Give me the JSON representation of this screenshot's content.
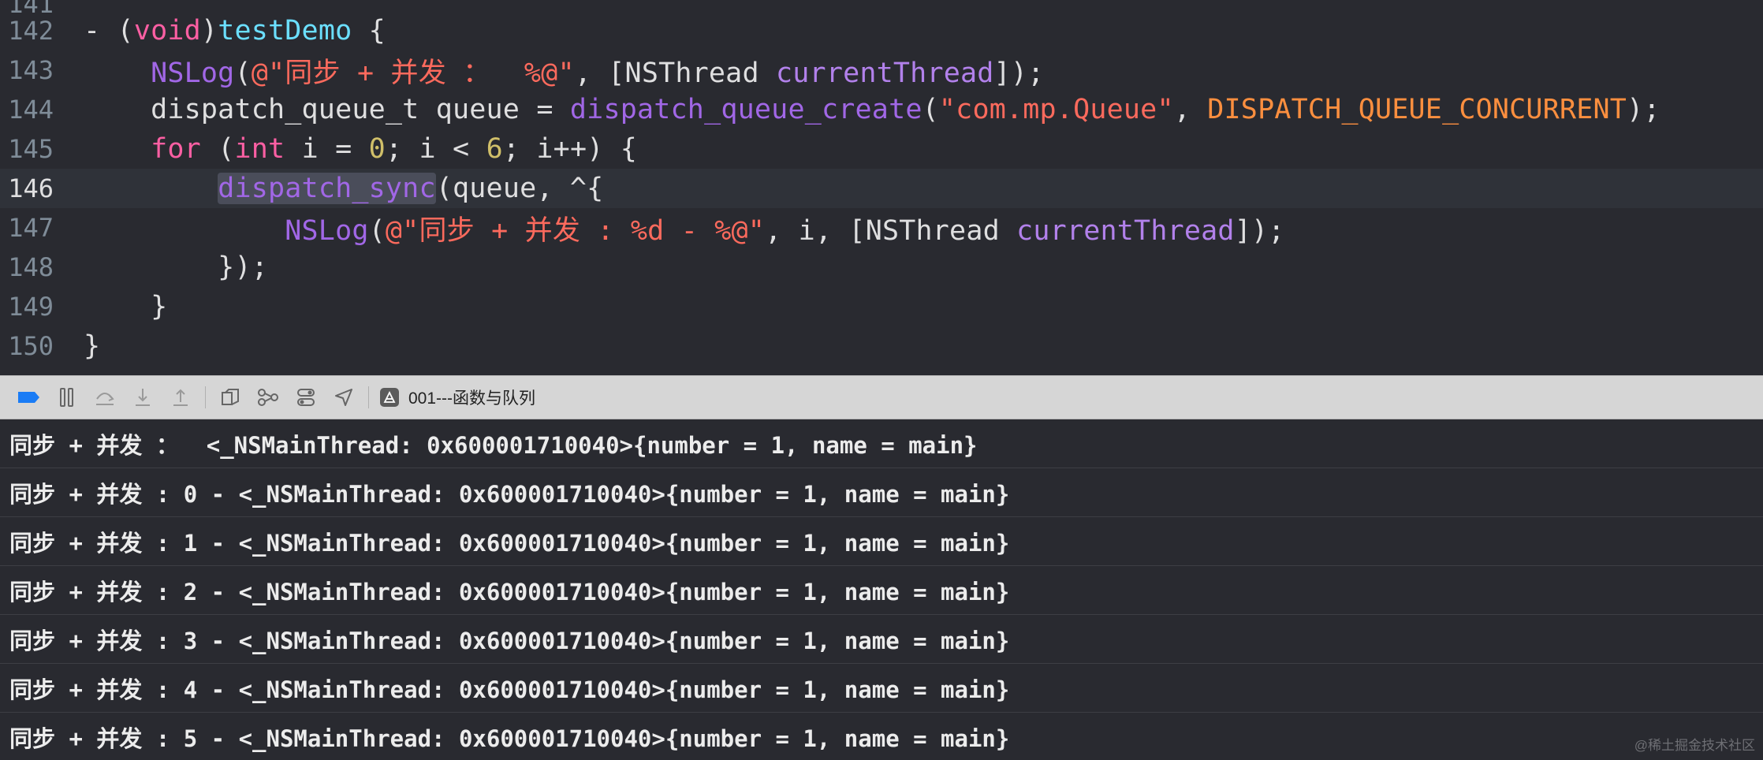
{
  "editor": {
    "lines": [
      {
        "num": "142",
        "tokens": [
          {
            "t": "- (",
            "c": ""
          },
          {
            "t": "void",
            "c": "t-kw"
          },
          {
            "t": ")",
            "c": ""
          },
          {
            "t": "testDemo",
            "c": "t-def"
          },
          {
            "t": " {",
            "c": ""
          }
        ]
      },
      {
        "num": "143",
        "tokens": [
          {
            "t": "    ",
            "c": ""
          },
          {
            "t": "NSLog",
            "c": "t-fn"
          },
          {
            "t": "(",
            "c": ""
          },
          {
            "t": "@\"同步 + 并发 ：  %@\"",
            "c": "t-str"
          },
          {
            "t": ", [NSThread ",
            "c": ""
          },
          {
            "t": "currentThread",
            "c": "t-fn2"
          },
          {
            "t": "]);",
            "c": ""
          }
        ]
      },
      {
        "num": "144",
        "tokens": [
          {
            "t": "    ",
            "c": ""
          },
          {
            "t": "dispatch_queue_t",
            "c": ""
          },
          {
            "t": " queue = ",
            "c": ""
          },
          {
            "t": "dispatch_queue_create",
            "c": "t-fn"
          },
          {
            "t": "(",
            "c": ""
          },
          {
            "t": "\"com.mp.Queue\"",
            "c": "t-str"
          },
          {
            "t": ", ",
            "c": ""
          },
          {
            "t": "DISPATCH_QUEUE_CONCURRENT",
            "c": "t-macro"
          },
          {
            "t": ");",
            "c": ""
          }
        ]
      },
      {
        "num": "145",
        "tokens": [
          {
            "t": "    ",
            "c": ""
          },
          {
            "t": "for",
            "c": "t-kw"
          },
          {
            "t": " (",
            "c": ""
          },
          {
            "t": "int",
            "c": "t-kw"
          },
          {
            "t": " i = ",
            "c": ""
          },
          {
            "t": "0",
            "c": "t-num"
          },
          {
            "t": "; i < ",
            "c": ""
          },
          {
            "t": "6",
            "c": "t-num"
          },
          {
            "t": "; i++) {",
            "c": ""
          }
        ]
      },
      {
        "num": "146",
        "current": true,
        "tokens": [
          {
            "t": "        ",
            "c": ""
          },
          {
            "t": "dispatch_sync",
            "c": "t-fn hl"
          },
          {
            "t": "(queue, ^{",
            "c": ""
          }
        ]
      },
      {
        "num": "147",
        "tokens": [
          {
            "t": "            ",
            "c": ""
          },
          {
            "t": "NSLog",
            "c": "t-fn"
          },
          {
            "t": "(",
            "c": ""
          },
          {
            "t": "@\"同步 + 并发 : %d - %@\"",
            "c": "t-str"
          },
          {
            "t": ", i, [NSThread ",
            "c": ""
          },
          {
            "t": "currentThread",
            "c": "t-fn2"
          },
          {
            "t": "]);",
            "c": ""
          }
        ]
      },
      {
        "num": "148",
        "tokens": [
          {
            "t": "        });",
            "c": ""
          }
        ]
      },
      {
        "num": "149",
        "tokens": [
          {
            "t": "    }",
            "c": ""
          }
        ]
      },
      {
        "num": "150",
        "tokens": [
          {
            "t": "}",
            "c": ""
          }
        ]
      }
    ]
  },
  "toolbar": {
    "buttons": [
      {
        "name": "breakpoints-toggle-icon",
        "interactable": true
      },
      {
        "name": "pause-icon",
        "interactable": true
      },
      {
        "name": "step-over-icon",
        "interactable": true
      },
      {
        "name": "step-into-icon",
        "interactable": true
      },
      {
        "name": "step-out-icon",
        "interactable": true
      },
      {
        "name": "view-hierarchy-icon",
        "interactable": true
      },
      {
        "name": "memory-graph-icon",
        "interactable": true
      },
      {
        "name": "environment-overrides-icon",
        "interactable": true
      },
      {
        "name": "simulate-location-icon",
        "interactable": true
      }
    ],
    "target_label": "001---函数与队列"
  },
  "console": {
    "lines": [
      "同步 + 并发 ：  <_NSMainThread: 0x600001710040>{number = 1, name = main}",
      "同步 + 并发 : 0 - <_NSMainThread: 0x600001710040>{number = 1, name = main}",
      "同步 + 并发 : 1 - <_NSMainThread: 0x600001710040>{number = 1, name = main}",
      "同步 + 并发 : 2 - <_NSMainThread: 0x600001710040>{number = 1, name = main}",
      "同步 + 并发 : 3 - <_NSMainThread: 0x600001710040>{number = 1, name = main}",
      "同步 + 并发 : 4 - <_NSMainThread: 0x600001710040>{number = 1, name = main}",
      "同步 + 并发 : 5 - <_NSMainThread: 0x600001710040>{number = 1, name = main}"
    ]
  },
  "watermark": "@稀土掘金技术社区"
}
